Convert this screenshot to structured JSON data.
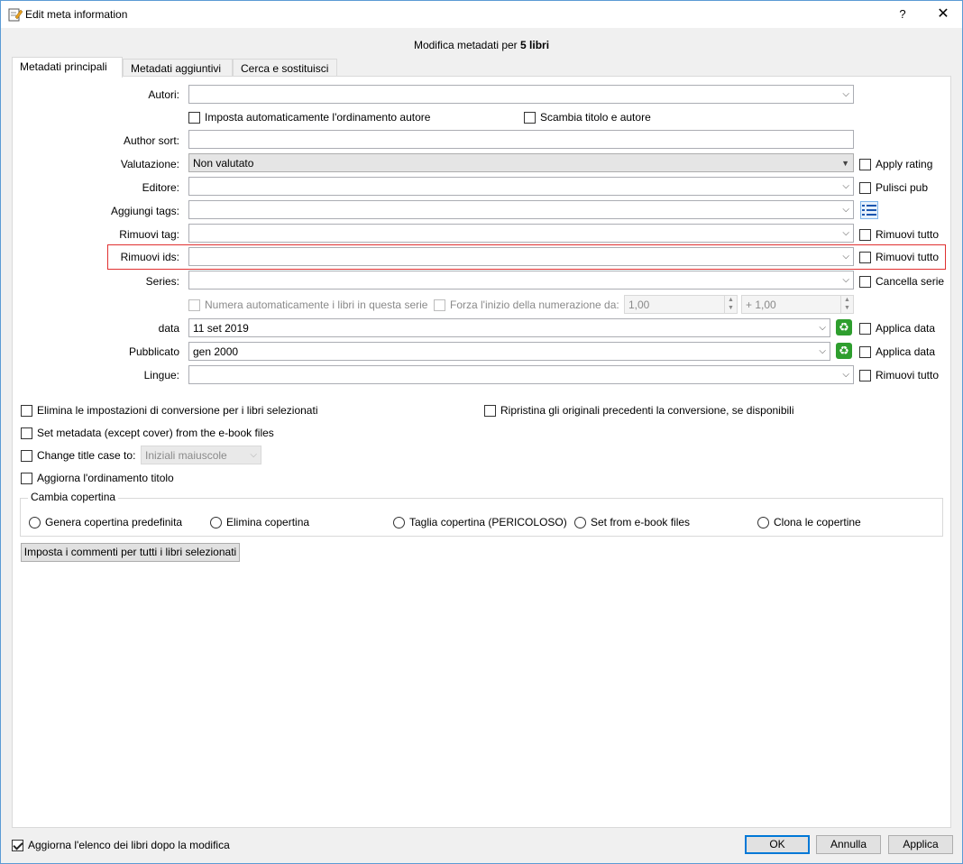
{
  "window": {
    "title": "Edit meta information",
    "help": "?",
    "close": "✕"
  },
  "heading": {
    "prefix": "Modifica metadati per ",
    "count": "5 libri"
  },
  "tabs": [
    {
      "label": "Metadati principali"
    },
    {
      "label": "Metadati aggiuntivi"
    },
    {
      "label": "Cerca e sostituisci"
    }
  ],
  "form": {
    "autori": {
      "label": "Autori:",
      "value": ""
    },
    "auto_sort": {
      "label": "Imposta automaticamente l'ordinamento autore",
      "checked": false
    },
    "swap": {
      "label": "Scambia titolo e autore",
      "checked": false
    },
    "author_sort": {
      "label": "Author sort:",
      "value": ""
    },
    "valutazione": {
      "label": "Valutazione:",
      "value": "Non valutato",
      "check": "Apply rating"
    },
    "editore": {
      "label": "Editore:",
      "value": "",
      "check": "Pulisci pub"
    },
    "aggiungi_tags": {
      "label": "Aggiungi tags:",
      "value": ""
    },
    "rimuovi_tag": {
      "label": "Rimuovi tag:",
      "value": "",
      "check": "Rimuovi tutto"
    },
    "rimuovi_ids": {
      "label": "Rimuovi ids:",
      "value": "",
      "check": "Rimuovi tutto"
    },
    "series": {
      "label": "Series:",
      "value": "",
      "check": "Cancella serie"
    },
    "autonumber": {
      "label": "Numera automaticamente i libri in questa serie"
    },
    "force_start": {
      "label": "Forza l'inizio della numerazione da:",
      "start": "1,00",
      "step": "+ 1,00"
    },
    "data": {
      "label": "data",
      "value": "11 set 2019",
      "check": "Applica data"
    },
    "pubblicato": {
      "label": "Pubblicato",
      "value": "gen 2000",
      "check": "Applica data"
    },
    "lingue": {
      "label": "Lingue:",
      "value": "",
      "check": "Rimuovi tutto"
    }
  },
  "options": {
    "elimina_conv": "Elimina le impostazioni di conversione per i libri selezionati",
    "ripristina": "Ripristina gli originali precedenti la conversione, se disponibili",
    "set_metadata": "Set metadata (except cover) from the e-book files",
    "change_case": "Change title case to:",
    "case_value": "Iniziali maiuscole",
    "aggiorna_ord": "Aggiorna l'ordinamento titolo"
  },
  "cover": {
    "legend": "Cambia copertina",
    "options": [
      "Genera copertina predefinita",
      "Elimina copertina",
      "Taglia copertina (PERICOLOSO)",
      "Set from e-book files",
      "Clona le copertine"
    ]
  },
  "comments_button": "Imposta i commenti per tutti i libri selezionati",
  "footer": {
    "refresh_label": "Aggiorna l'elenco dei libri dopo la modifica",
    "refresh_checked": true,
    "ok": "OK",
    "cancel": "Annulla",
    "apply": "Applica"
  }
}
